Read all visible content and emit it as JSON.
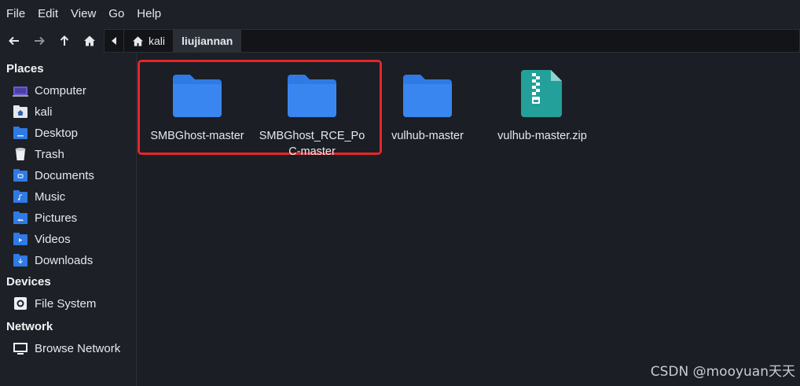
{
  "menu": [
    "File",
    "Edit",
    "View",
    "Go",
    "Help"
  ],
  "path": {
    "home": "kali",
    "current": "liujiannan"
  },
  "sidebar": {
    "places_title": "Places",
    "places": [
      {
        "label": "Computer",
        "icon": "computer-icon"
      },
      {
        "label": "kali",
        "icon": "home-folder-icon"
      },
      {
        "label": "Desktop",
        "icon": "desktop-folder-icon"
      },
      {
        "label": "Trash",
        "icon": "trash-icon"
      },
      {
        "label": "Documents",
        "icon": "documents-folder-icon"
      },
      {
        "label": "Music",
        "icon": "music-folder-icon"
      },
      {
        "label": "Pictures",
        "icon": "pictures-folder-icon"
      },
      {
        "label": "Videos",
        "icon": "videos-folder-icon"
      },
      {
        "label": "Downloads",
        "icon": "downloads-folder-icon"
      }
    ],
    "devices_title": "Devices",
    "devices": [
      {
        "label": "File System",
        "icon": "drive-icon"
      }
    ],
    "network_title": "Network",
    "network": [
      {
        "label": "Browse Network",
        "icon": "network-icon"
      }
    ]
  },
  "files": [
    {
      "name": "SMBGhost-master",
      "type": "folder"
    },
    {
      "name": "SMBGhost_RCE_PoC-master",
      "type": "folder"
    },
    {
      "name": "vulhub-master",
      "type": "folder"
    },
    {
      "name": "vulhub-master.zip",
      "type": "zip"
    }
  ],
  "watermark": "CSDN @mooyuan天天",
  "colors": {
    "folder": "#2f7ae5",
    "zip": "#23a09a",
    "highlight": "#e3262b"
  }
}
